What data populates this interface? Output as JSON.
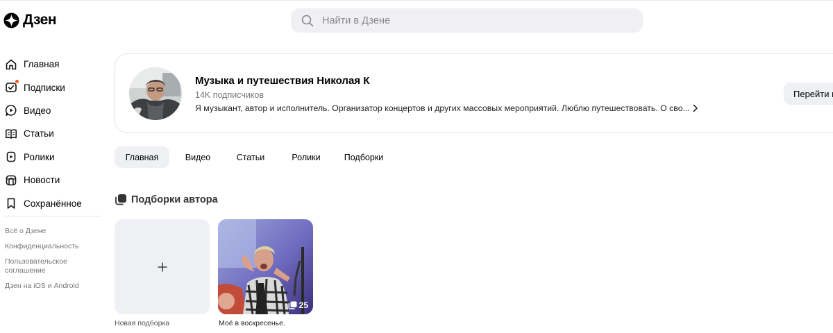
{
  "header": {
    "logo_text": "Дзен",
    "search_placeholder": "Найти в Дзене"
  },
  "sidebar": {
    "items": [
      {
        "label": "Главная",
        "icon": "home-icon"
      },
      {
        "label": "Подписки",
        "icon": "subscriptions-icon"
      },
      {
        "label": "Видео",
        "icon": "video-icon"
      },
      {
        "label": "Статьи",
        "icon": "articles-icon"
      },
      {
        "label": "Ролики",
        "icon": "shorts-icon"
      },
      {
        "label": "Новости",
        "icon": "news-icon"
      },
      {
        "label": "Сохранённое",
        "icon": "bookmark-icon"
      }
    ],
    "links": [
      "Всё о Дзене",
      "Конфиденциальность",
      "Пользовательское соглашение",
      "Дзен на iOS и Android"
    ]
  },
  "channel": {
    "title": "Музыка и путешествия Николая К",
    "subscribers": "14K подписчиков",
    "description": "Я музыкант, автор и исполнитель. Организатор концертов и других массовых мероприятий. Люблю путешествовать. О сво...",
    "go_button": "Перейти в"
  },
  "tabs": [
    {
      "label": "Главная",
      "active": true
    },
    {
      "label": "Видео",
      "active": false
    },
    {
      "label": "Статьи",
      "active": false
    },
    {
      "label": "Ролики",
      "active": false
    },
    {
      "label": "Подборки",
      "active": false
    }
  ],
  "collections": {
    "title": "Подборки автора",
    "new_label": "Новая подборка",
    "items": [
      {
        "caption": "Моё в воскресенье.",
        "count": "25"
      }
    ]
  },
  "colors": {
    "notification_dot": "#ff5a1f",
    "chip_bg": "#eef0f3"
  }
}
